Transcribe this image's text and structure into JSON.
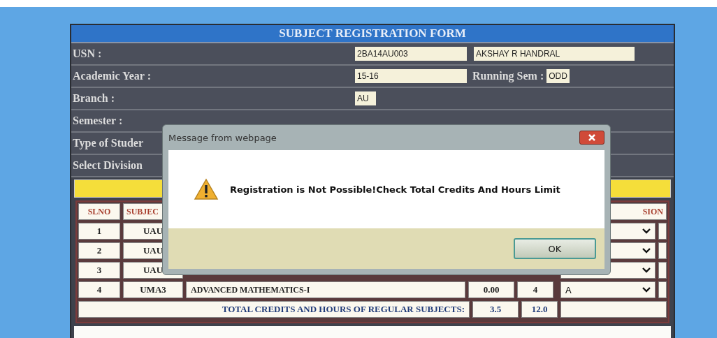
{
  "form": {
    "title": "SUBJECT REGISTRATION FORM",
    "fields": [
      {
        "label": "USN :",
        "values": [
          "2BA14AU003",
          "AKSHAY R HANDRAL"
        ]
      },
      {
        "label": "Academic Year :",
        "values": [
          "15-16"
        ],
        "extra_label": "Running Sem :",
        "extra_value": "ODD"
      },
      {
        "label": "Branch :",
        "values": [
          "AU"
        ]
      },
      {
        "label": "Semester :"
      },
      {
        "label": "Type of Studer"
      },
      {
        "label": "Select Division"
      }
    ],
    "table": {
      "columns": [
        "SLNO",
        "SUBJEC",
        "SION"
      ],
      "rows": [
        {
          "slno": "1",
          "code": "UAU"
        },
        {
          "slno": "2",
          "code": "UAU"
        },
        {
          "slno": "3",
          "code": "UAU"
        },
        {
          "slno": "4",
          "code": "UMA3",
          "name": "ADVANCED MATHEMATICS-I",
          "credits": "0.00",
          "hours": "4",
          "division": "A"
        }
      ],
      "total_label": "TOTAL CREDITS AND HOURS OF REGULAR SUBJECTS:",
      "total_credits": "3.5",
      "total_hours": "12.0"
    }
  },
  "dialog": {
    "title": "Message from webpage",
    "message": "Registration is Not Possible!Check Total Credits And Hours Limit",
    "buttons": [
      "OK"
    ]
  }
}
